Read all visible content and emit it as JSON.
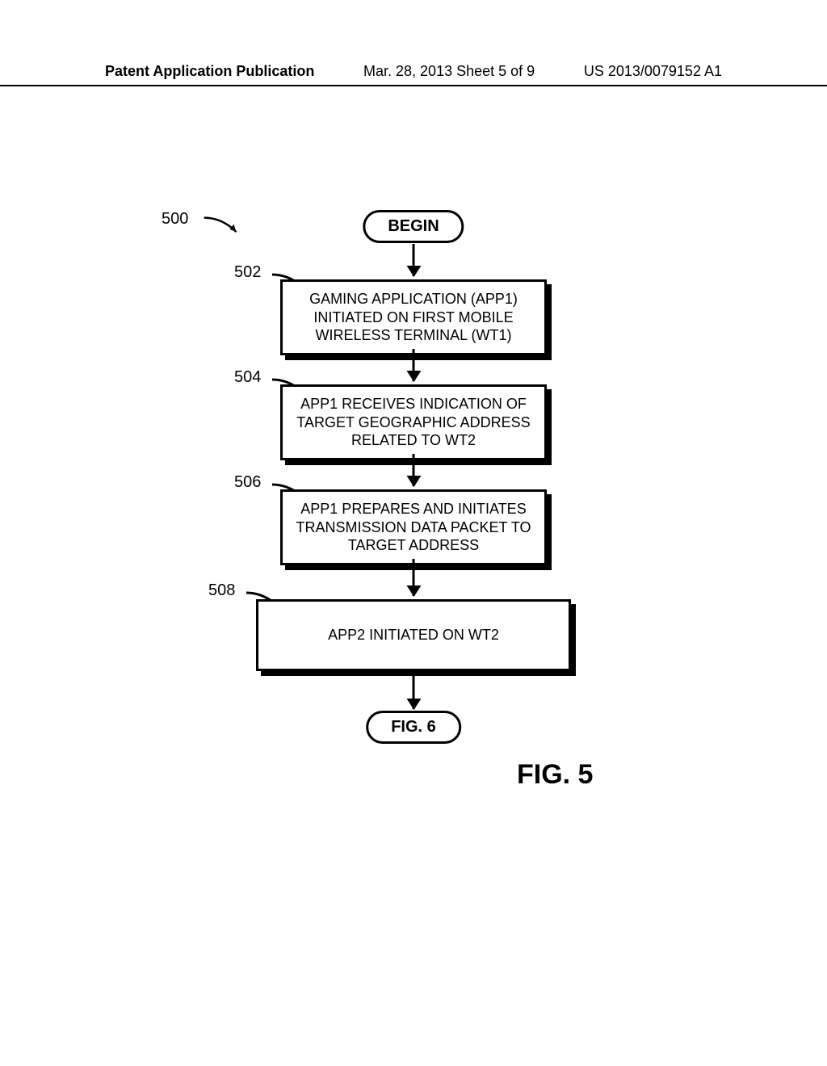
{
  "header": {
    "left": "Patent Application Publication",
    "center": "Mar. 28, 2013  Sheet 5 of 9",
    "right": "US 2013/0079152 A1"
  },
  "refs": {
    "r500": "500",
    "r502": "502",
    "r504": "504",
    "r506": "506",
    "r508": "508"
  },
  "terminators": {
    "begin": "BEGIN",
    "end": "FIG. 6"
  },
  "boxes": {
    "b502": "GAMING APPLICATION (APP1) INITIATED ON FIRST MOBILE WIRELESS TERMINAL (WT1)",
    "b504": "APP1 RECEIVES INDICATION OF TARGET GEOGRAPHIC ADDRESS RELATED TO WT2",
    "b506": "APP1 PREPARES AND INITIATES TRANSMISSION DATA PACKET TO TARGET ADDRESS",
    "b508": "APP2 INITIATED ON WT2"
  },
  "caption": "FIG. 5"
}
